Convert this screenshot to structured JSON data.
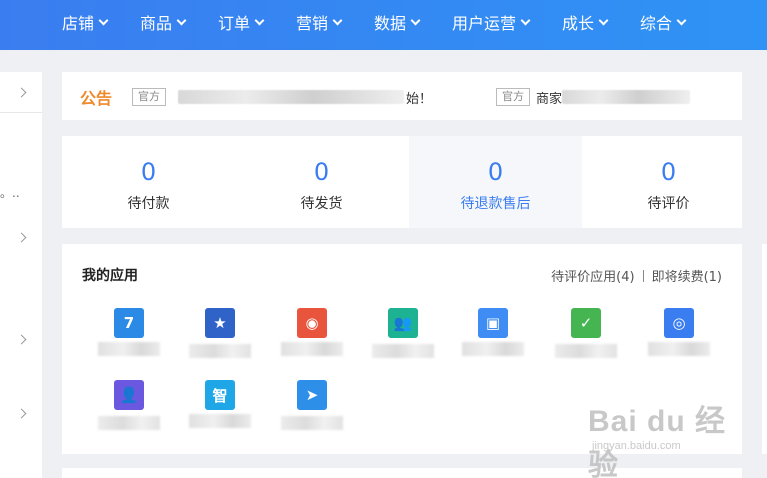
{
  "nav": {
    "items": [
      {
        "label": "店铺"
      },
      {
        "label": "商品"
      },
      {
        "label": "订单"
      },
      {
        "label": "营销"
      },
      {
        "label": "数据"
      },
      {
        "label": "用户运营"
      },
      {
        "label": "成长"
      },
      {
        "label": "综合"
      }
    ]
  },
  "sidebar": {
    "text": "。.."
  },
  "notice": {
    "title": "公告",
    "tag1": "官方",
    "text1_tail": "始！",
    "tag2": "官方",
    "text2_head": "商家"
  },
  "stats": [
    {
      "value": "0",
      "label": "待付款"
    },
    {
      "value": "0",
      "label": "待发货"
    },
    {
      "value": "0",
      "label": "待退款售后"
    },
    {
      "value": "0",
      "label": "待评价"
    }
  ],
  "apps": {
    "title": "我的应用",
    "link_review": "待评价应用(4)",
    "link_renew": "即将续费(1)",
    "items": [
      {
        "icon": "calendar-icon",
        "color": "#2a8ae6",
        "glyph": "7"
      },
      {
        "icon": "badge-icon",
        "color": "#2f63c8",
        "glyph": "★"
      },
      {
        "icon": "eye-icon",
        "color": "#e8553c",
        "glyph": "◉"
      },
      {
        "icon": "users-icon",
        "color": "#1db392",
        "glyph": "👥"
      },
      {
        "icon": "bag-icon",
        "color": "#3f8cf4",
        "glyph": "▣"
      },
      {
        "icon": "calendar-check-icon",
        "color": "#45b551",
        "glyph": "✓"
      },
      {
        "icon": "compass-icon",
        "color": "#3a7df0",
        "glyph": "◎"
      },
      {
        "icon": "user-settings-icon",
        "color": "#6a59e0",
        "glyph": "👤"
      },
      {
        "icon": "zhi-icon",
        "color": "#1ea6e6",
        "glyph": "智"
      },
      {
        "icon": "paper-plane-icon",
        "color": "#2e8fe8",
        "glyph": "➤"
      }
    ]
  },
  "watermark": {
    "main": "Bai du 经验",
    "sub": "jingyan.baidu.com"
  },
  "colors": {
    "nav_bg": "#3a7df0",
    "accent": "#3a7df0",
    "notice_title": "#f0892a"
  }
}
